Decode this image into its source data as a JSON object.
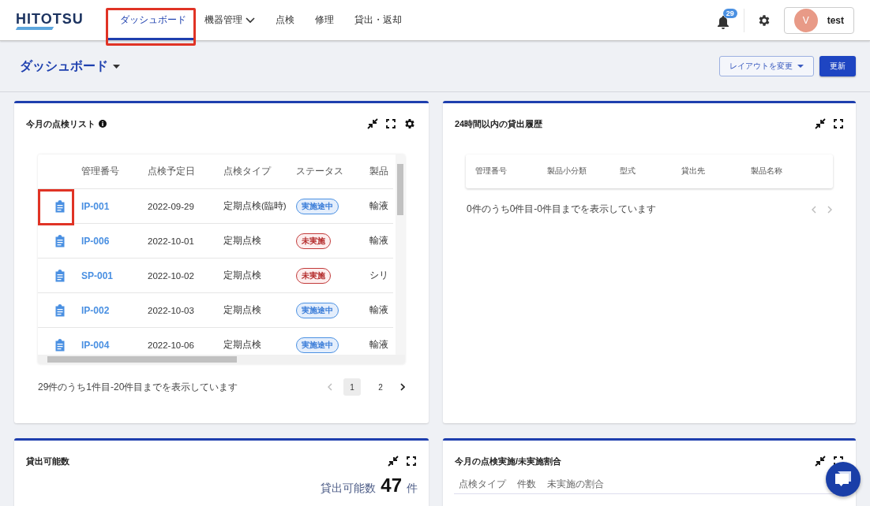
{
  "header": {
    "logo": "HITOTSU",
    "nav": [
      {
        "label": "ダッシュボード",
        "selected": true,
        "highlighted": true,
        "dropdown": false
      },
      {
        "label": "機器管理",
        "selected": false,
        "highlighted": false,
        "dropdown": true
      },
      {
        "label": "点検",
        "selected": false,
        "highlighted": false,
        "dropdown": false
      },
      {
        "label": "修理",
        "selected": false,
        "highlighted": false,
        "dropdown": false
      },
      {
        "label": "貸出・返却",
        "selected": false,
        "highlighted": false,
        "dropdown": false
      }
    ],
    "notification_count": "29",
    "user": {
      "initial": "V",
      "name": "test"
    }
  },
  "toolbar": {
    "title": "ダッシュボード",
    "layout_button": "レイアウトを変更",
    "refresh_button": "更新"
  },
  "inspection_card": {
    "title": "今月の点検リスト",
    "columns": [
      "管理番号",
      "点検予定日",
      "点検タイプ",
      "ステータス",
      "製品"
    ],
    "rows": [
      {
        "icon_highlighted": true,
        "id": "IP-001",
        "date": "2022-09-29",
        "type": "定期点検(臨時)",
        "status": {
          "label": "実施途中",
          "kind": "in_progress"
        },
        "product": "輸液"
      },
      {
        "icon_highlighted": false,
        "id": "IP-006",
        "date": "2022-10-01",
        "type": "定期点検",
        "status": {
          "label": "未実施",
          "kind": "not_done"
        },
        "product": "輸液"
      },
      {
        "icon_highlighted": false,
        "id": "SP-001",
        "date": "2022-10-02",
        "type": "定期点検",
        "status": {
          "label": "未実施",
          "kind": "not_done"
        },
        "product": "シリ"
      },
      {
        "icon_highlighted": false,
        "id": "IP-002",
        "date": "2022-10-03",
        "type": "定期点検",
        "status": {
          "label": "実施途中",
          "kind": "in_progress"
        },
        "product": "輸液"
      },
      {
        "icon_highlighted": false,
        "id": "IP-004",
        "date": "2022-10-06",
        "type": "定期点検",
        "status": {
          "label": "実施途中",
          "kind": "in_progress"
        },
        "product": "輸液"
      }
    ],
    "summary": "29件のうち1件目-20件目までを表示しています",
    "pages": [
      {
        "label": "1",
        "selected": true
      },
      {
        "label": "2",
        "selected": false
      }
    ]
  },
  "lending_card": {
    "title": "24時間以内の貸出履歴",
    "columns": [
      "管理番号",
      "製品小分類",
      "型式",
      "貸出先",
      "製品名称"
    ],
    "summary": "0件のうち0件目-0件目までを表示しています"
  },
  "available_card": {
    "title": "貸出可能数",
    "label": "貸出可能数",
    "count": "47",
    "unit": "件"
  },
  "ratio_card": {
    "title": "今月の点検実施/未実施割合",
    "columns": [
      "点検タイプ",
      "件数",
      "未実施の割合"
    ]
  }
}
